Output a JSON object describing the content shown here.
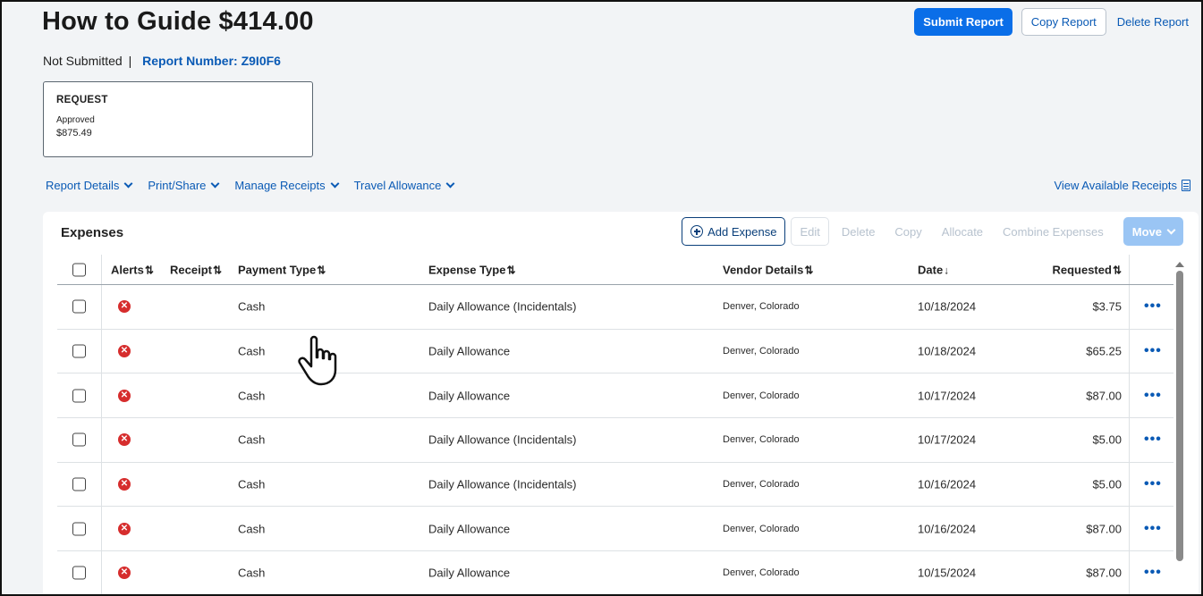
{
  "header": {
    "title": "How to Guide $414.00",
    "status": "Not Submitted",
    "separator": "|",
    "report_number": "Report Number: Z9I0F6",
    "actions": {
      "submit": "Submit Report",
      "copy": "Copy Report",
      "delete": "Delete Report"
    }
  },
  "request_card": {
    "title": "REQUEST",
    "status": "Approved",
    "amount": "$875.49"
  },
  "menus": {
    "report_details": "Report Details",
    "print_share": "Print/Share",
    "manage_receipts": "Manage Receipts",
    "travel_allowance": "Travel Allowance",
    "view_receipts": "View Available Receipts"
  },
  "expenses": {
    "title": "Expenses",
    "toolbar": {
      "add": "Add Expense",
      "edit": "Edit",
      "delete": "Delete",
      "copy": "Copy",
      "allocate": "Allocate",
      "combine": "Combine Expenses",
      "move": "Move"
    },
    "columns": {
      "alerts": "Alerts",
      "receipt": "Receipt",
      "payment_type": "Payment Type",
      "expense_type": "Expense Type",
      "vendor": "Vendor Details",
      "date": "Date",
      "requested": "Requested"
    },
    "rows": [
      {
        "payment": "Cash",
        "expense": "Daily Allowance (Incidentals)",
        "vendor": "Denver, Colorado",
        "date": "10/18/2024",
        "amount": "$3.75"
      },
      {
        "payment": "Cash",
        "expense": "Daily Allowance",
        "vendor": "Denver, Colorado",
        "date": "10/18/2024",
        "amount": "$65.25"
      },
      {
        "payment": "Cash",
        "expense": "Daily Allowance",
        "vendor": "Denver, Colorado",
        "date": "10/17/2024",
        "amount": "$87.00"
      },
      {
        "payment": "Cash",
        "expense": "Daily Allowance (Incidentals)",
        "vendor": "Denver, Colorado",
        "date": "10/17/2024",
        "amount": "$5.00"
      },
      {
        "payment": "Cash",
        "expense": "Daily Allowance (Incidentals)",
        "vendor": "Denver, Colorado",
        "date": "10/16/2024",
        "amount": "$5.00"
      },
      {
        "payment": "Cash",
        "expense": "Daily Allowance",
        "vendor": "Denver, Colorado",
        "date": "10/16/2024",
        "amount": "$87.00"
      },
      {
        "payment": "Cash",
        "expense": "Daily Allowance",
        "vendor": "Denver, Colorado",
        "date": "10/15/2024",
        "amount": "$87.00"
      }
    ]
  },
  "colors": {
    "primary": "#0a6ee8",
    "link": "#0a5ab5",
    "alert": "#d62d2d",
    "disabled": "#b7c2ce",
    "move_disabled": "#9ac5f4"
  },
  "icons": {
    "alert": "alert-x-circle-icon",
    "more": "more-horizontal-icon",
    "receipt": "receipt-icon",
    "add": "plus-circle-icon",
    "sort": "sort-arrows-icon",
    "cursor": "hand-pointer-icon"
  }
}
